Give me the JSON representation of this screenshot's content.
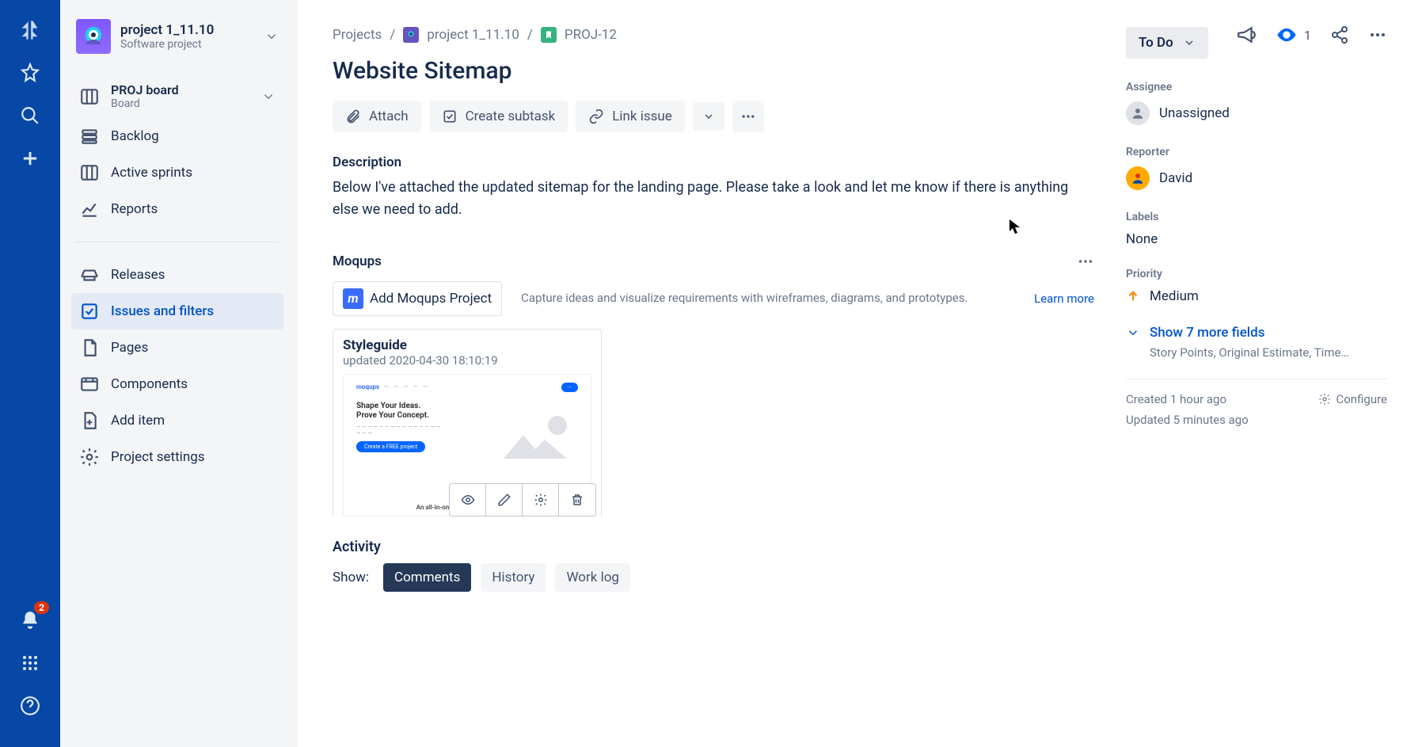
{
  "project": {
    "name": "project 1_11.10",
    "type": "Software project"
  },
  "board": {
    "name": "PROJ board",
    "sub": "Board"
  },
  "sidebar": {
    "backlog": "Backlog",
    "sprints": "Active sprints",
    "reports": "Reports",
    "releases": "Releases",
    "issues": "Issues and filters",
    "pages": "Pages",
    "components": "Components",
    "additem": "Add item",
    "settings": "Project settings"
  },
  "crumb": {
    "projects": "Projects",
    "project": "project 1_11.10",
    "key": "PROJ-12"
  },
  "issue": {
    "title": "Website Sitemap",
    "attach": "Attach",
    "subtask": "Create subtask",
    "link": "Link issue",
    "descLabel": "Description",
    "desc": "Below I've attached the updated sitemap for the landing page. Please take a look and let me know if there is anything else we need to add."
  },
  "moqups": {
    "label": "Moqups",
    "add": "Add Moqups Project",
    "desc": "Capture ideas and visualize requirements with wireframes, diagrams, and prototypes.",
    "learn": "Learn more",
    "card": {
      "title": "Styleguide",
      "updated": "updated 2020-04-30 18:10:19",
      "thumbBrand": "moqups",
      "heroLine1": "Shape Your Ideas.",
      "heroLine2": "Prove Your Concept.",
      "cta": "Create a FREE project",
      "footer": "An all-in-one online design platform"
    }
  },
  "activity": {
    "label": "Activity",
    "show": "Show:",
    "comments": "Comments",
    "history": "History",
    "worklog": "Work log"
  },
  "top": {
    "watchers": "1"
  },
  "details": {
    "status": "To Do",
    "assigneeLabel": "Assignee",
    "assignee": "Unassigned",
    "reporterLabel": "Reporter",
    "reporter": "David",
    "labelsLabel": "Labels",
    "labels": "None",
    "priorityLabel": "Priority",
    "priority": "Medium",
    "showMore": "Show 7 more fields",
    "showMoreSub": "Story Points, Original Estimate, Time…",
    "created": "Created 1 hour ago",
    "updated": "Updated 5 minutes ago",
    "configure": "Configure"
  },
  "rail": {
    "notif": "2"
  }
}
